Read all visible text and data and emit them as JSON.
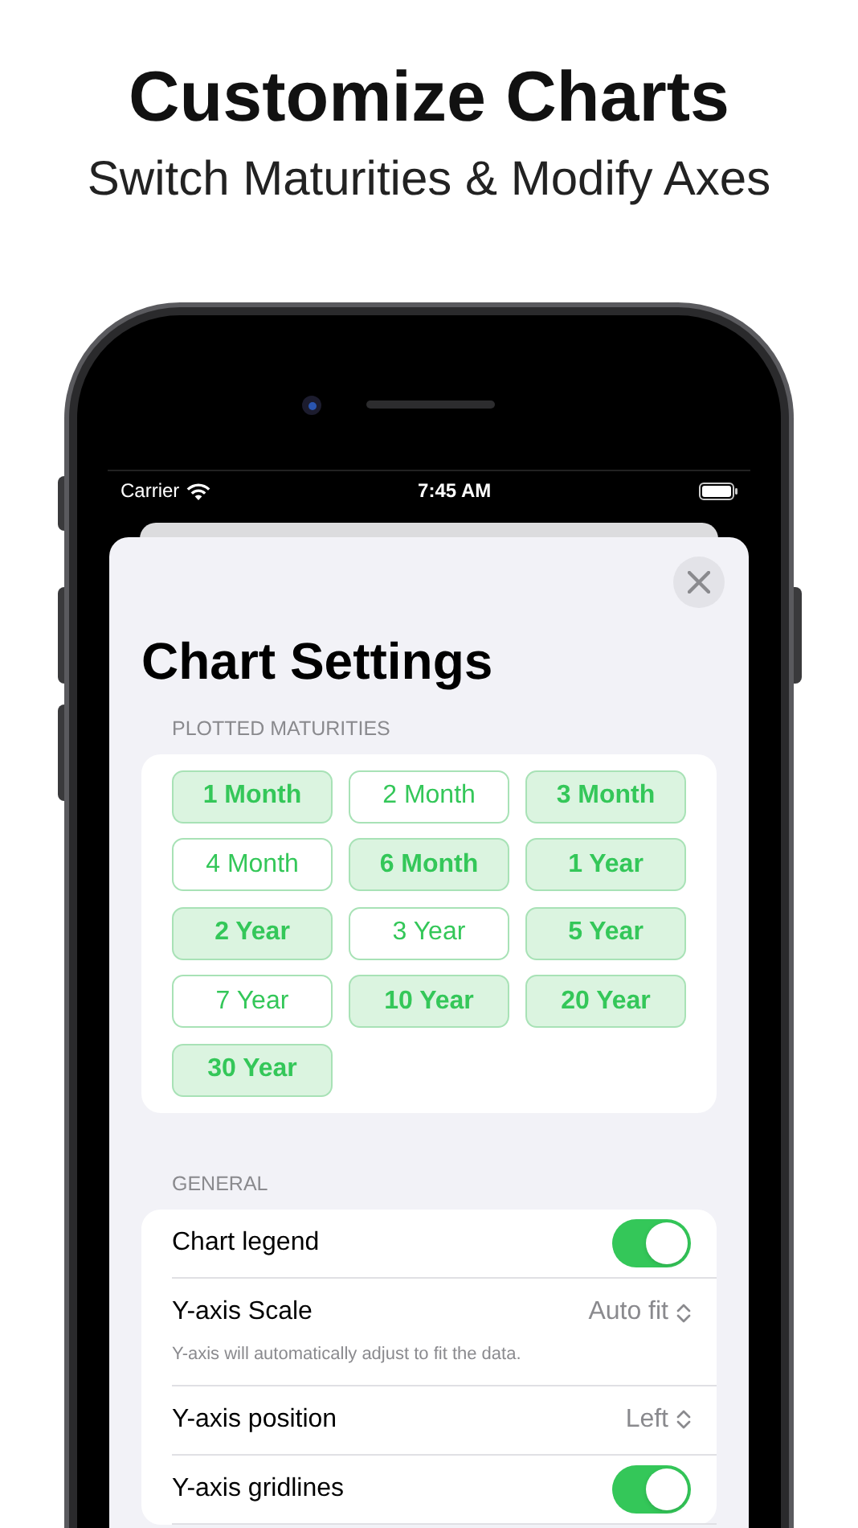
{
  "headline": "Customize Charts",
  "subheadline": "Switch Maturities & Modify Axes",
  "status_bar": {
    "carrier": "Carrier",
    "time": "7:45 AM"
  },
  "sheet": {
    "title": "Chart Settings",
    "maturities": {
      "header": "PLOTTED MATURITIES",
      "items": [
        {
          "label": "1 Month",
          "selected": true
        },
        {
          "label": "2 Month",
          "selected": false
        },
        {
          "label": "3 Month",
          "selected": true
        },
        {
          "label": "4 Month",
          "selected": false
        },
        {
          "label": "6 Month",
          "selected": true
        },
        {
          "label": "1 Year",
          "selected": true
        },
        {
          "label": "2 Year",
          "selected": true
        },
        {
          "label": "3 Year",
          "selected": false
        },
        {
          "label": "5 Year",
          "selected": true
        },
        {
          "label": "7 Year",
          "selected": false
        },
        {
          "label": "10 Year",
          "selected": true
        },
        {
          "label": "20 Year",
          "selected": true
        },
        {
          "label": "30 Year",
          "selected": true
        }
      ]
    },
    "general": {
      "header": "GENERAL",
      "rows": [
        {
          "kind": "toggle",
          "label": "Chart legend",
          "on": true
        },
        {
          "kind": "picker",
          "label": "Y-axis Scale",
          "value": "Auto fit",
          "note": "Y-axis will automatically adjust to fit the data."
        },
        {
          "kind": "picker",
          "label": "Y-axis position",
          "value": "Left"
        },
        {
          "kind": "toggle",
          "label": "Y-axis gridlines",
          "on": true
        }
      ]
    }
  }
}
